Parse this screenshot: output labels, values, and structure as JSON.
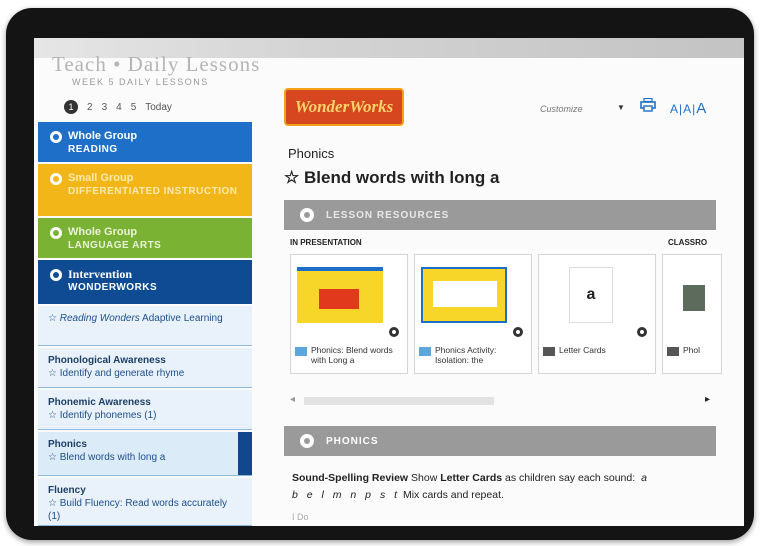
{
  "header": {
    "title": "Teach • Daily Lessons",
    "subtitle": "WEEK 5 DAILY LESSONS"
  },
  "days": {
    "items": [
      "1",
      "2",
      "3",
      "4",
      "5"
    ],
    "today_label": "Today"
  },
  "sidebar": {
    "groups": [
      {
        "title": "Whole Group",
        "subtitle": "READING"
      },
      {
        "title": "Small Group",
        "subtitle": "DIFFERENTIATED INSTRUCTION"
      },
      {
        "title": "Whole Group",
        "subtitle": "LANGUAGE ARTS"
      },
      {
        "title": "Intervention",
        "subtitle": "WONDERWORKS"
      }
    ],
    "items": [
      {
        "heading": "",
        "text": "Reading Wonders Adaptive Learning",
        "text_prefix": "☆ ",
        "italic_part": "Reading Wonders",
        "rest": " Adaptive Learning"
      },
      {
        "heading": "Phonological Awareness",
        "text": "☆ Identify and generate rhyme"
      },
      {
        "heading": "Phonemic Awareness",
        "text": "☆ Identify phonemes (1)"
      },
      {
        "heading": "Phonics",
        "text": "☆ Blend words with long a"
      },
      {
        "heading": "Fluency",
        "text": "☆ Build Fluency: Read words accurately (1)"
      }
    ]
  },
  "toolbar": {
    "logo_text": "WonderWorks",
    "customize_label": "Customize",
    "font_sizes": [
      "A",
      "|",
      "A",
      "|",
      "A"
    ]
  },
  "main": {
    "breadcrumb": "Phonics",
    "lesson_title": "Blend words with long a",
    "star": "☆",
    "sections": {
      "resources": "LESSON RESOURCES",
      "phonics": "PHONICS"
    },
    "in_presentation_label": "IN PRESENTATION",
    "classroom_label": "CLASSRO",
    "cards": [
      {
        "caption": "Phonics: Blend words with Long a"
      },
      {
        "caption": "Phonics Activity: Isolation: the"
      },
      {
        "caption": "Letter Cards",
        "letter": "a"
      },
      {
        "caption": "Phol"
      }
    ],
    "review": {
      "heading": "Sound-Spelling Review",
      "text1": " Show ",
      "bold2": "Letter Cards",
      "text2": " as children say each sound:",
      "letters_a": " a",
      "letters": "b e l m n p s t",
      "text3": " Mix cards and repeat."
    },
    "footer_text": "I Do"
  },
  "colors": {
    "blue": "#1e6fc8",
    "yellow": "#f2b619",
    "green": "#7ab233",
    "navy": "#0f4b92",
    "section_bar": "#9a9a9a"
  }
}
